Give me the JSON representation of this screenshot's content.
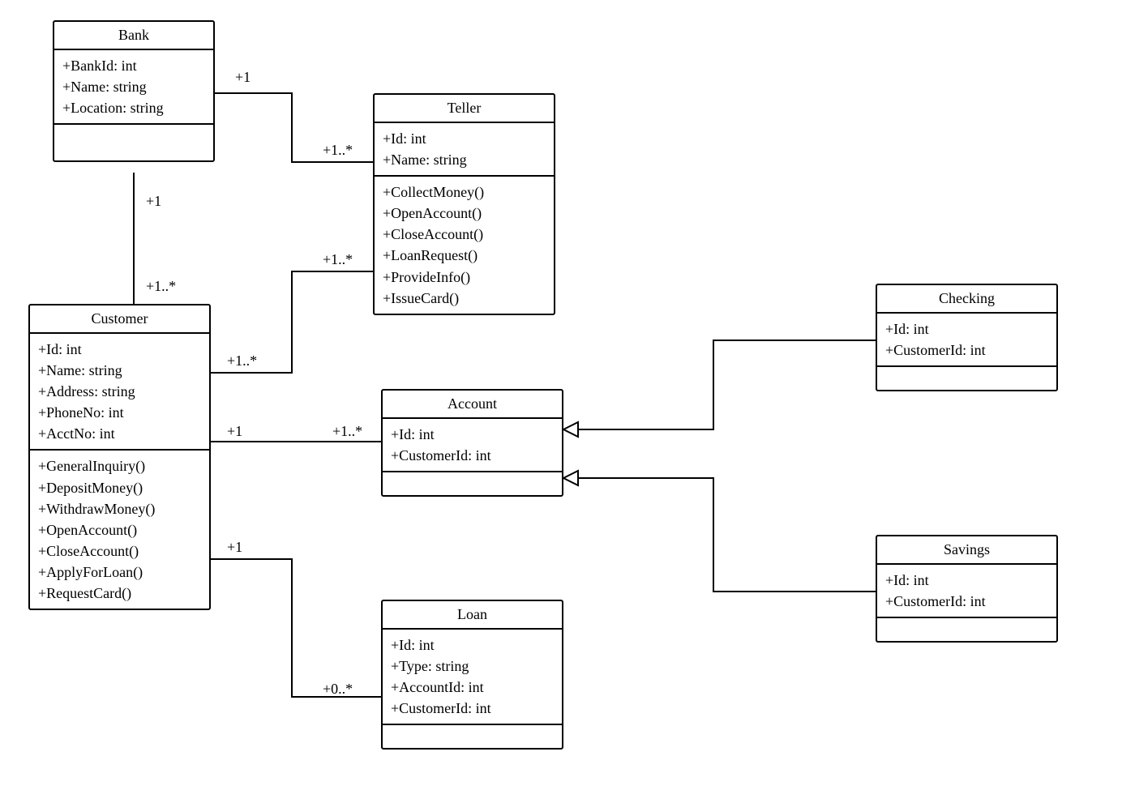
{
  "classes": {
    "bank": {
      "name": "Bank",
      "attrs": [
        "+BankId: int",
        "+Name: string",
        "+Location: string"
      ],
      "ops": []
    },
    "teller": {
      "name": "Teller",
      "attrs": [
        "+Id: int",
        "+Name: string"
      ],
      "ops": [
        "+CollectMoney()",
        "+OpenAccount()",
        "+CloseAccount()",
        "+LoanRequest()",
        "+ProvideInfo()",
        "+IssueCard()"
      ]
    },
    "customer": {
      "name": "Customer",
      "attrs": [
        "+Id: int",
        "+Name: string",
        "+Address: string",
        "+PhoneNo: int",
        "+AcctNo: int"
      ],
      "ops": [
        "+GeneralInquiry()",
        "+DepositMoney()",
        "+WithdrawMoney()",
        "+OpenAccount()",
        "+CloseAccount()",
        "+ApplyForLoan()",
        "+RequestCard()"
      ]
    },
    "account": {
      "name": "Account",
      "attrs": [
        "+Id: int",
        "+CustomerId: int"
      ],
      "ops": []
    },
    "loan": {
      "name": "Loan",
      "attrs": [
        "+Id: int",
        "+Type: string",
        "+AccountId: int",
        "+CustomerId: int"
      ],
      "ops": []
    },
    "checking": {
      "name": "Checking",
      "attrs": [
        "+Id: int",
        "+CustomerId: int"
      ],
      "ops": []
    },
    "savings": {
      "name": "Savings",
      "attrs": [
        "+Id: int",
        "+CustomerId: int"
      ],
      "ops": []
    }
  },
  "mult": {
    "bank_teller_bank": "+1",
    "bank_teller_teller": "+1..*",
    "bank_customer_bank": "+1",
    "bank_customer_customer": "+1..*",
    "customer_teller_customer": "+1..*",
    "customer_teller_teller": "+1..*",
    "customer_account_customer": "+1",
    "customer_account_account": "+1..*",
    "customer_loan_customer": "+1",
    "customer_loan_loan": "+0..*"
  }
}
